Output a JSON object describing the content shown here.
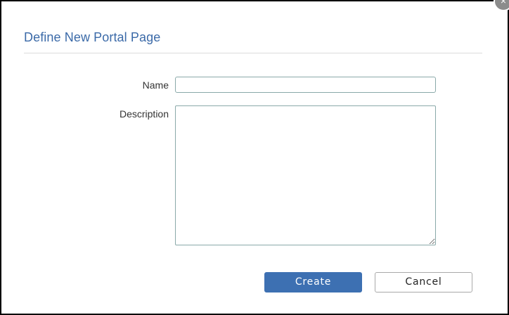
{
  "dialog": {
    "title": "Define New Portal Page",
    "close_icon": "close-icon",
    "close_glyph": "×"
  },
  "form": {
    "name_label": "Name",
    "name_value": "",
    "description_label": "Description",
    "description_value": ""
  },
  "actions": {
    "create_label": "Create",
    "cancel_label": "Cancel"
  },
  "colors": {
    "title": "#3b6aa8",
    "primary_button": "#3d70b2",
    "input_border": "#8aa9a9"
  }
}
